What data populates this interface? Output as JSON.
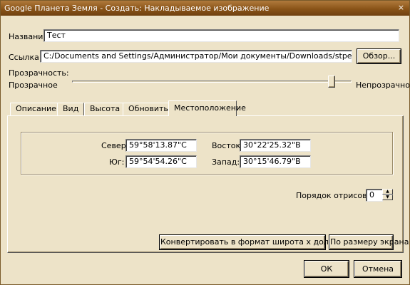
{
  "window": {
    "title": "Google Планета Земля - Создать: Накладываемое изображение",
    "close_glyph": "×"
  },
  "form": {
    "name_label": "Название:",
    "name_value": "Тест",
    "link_label": "Ссылка:",
    "link_value": "C:/Documents and Settings/Администратор/Мои документы/Downloads/stpeters.jpg",
    "browse_button": "Обзор..."
  },
  "transparency": {
    "label": "Прозрачность:",
    "min_label": "Прозрачное",
    "max_label": "Непрозрачное",
    "level": 1.0
  },
  "tabs": [
    {
      "label": "Описание"
    },
    {
      "label": "Вид"
    },
    {
      "label": "Высота"
    },
    {
      "label": "Обновить"
    },
    {
      "label": "Местоположение"
    }
  ],
  "location": {
    "north_label": "Север:",
    "north_value": "59°58'13.87\"С",
    "south_label": "Юг:",
    "south_value": "59°54'54.26\"С",
    "east_label": "Восток:",
    "east_value": "30°22'25.32\"В",
    "west_label": "Запад:",
    "west_value": "30°15'46.79\"В"
  },
  "draw_order": {
    "label": "Порядок отрисовки:",
    "value": "0",
    "up_glyph": "▲",
    "down_glyph": "▼"
  },
  "buttons": {
    "convert": "Конвертировать в формат широта x долгота x лист",
    "fit_screen": "По размеру экрана",
    "ok": "ОК",
    "cancel": "Отмена"
  }
}
